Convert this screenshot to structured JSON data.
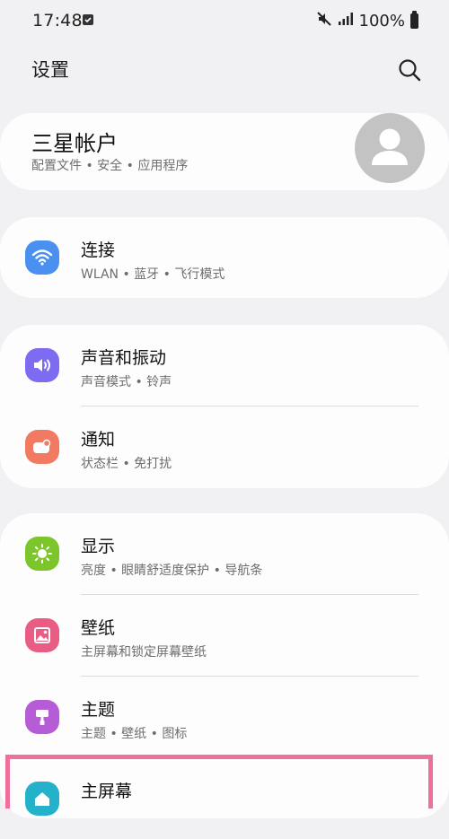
{
  "status_bar": {
    "time": "17:48",
    "battery": "100%",
    "icons": [
      "check-box-icon",
      "mute-icon",
      "signal-icon",
      "battery-icon"
    ]
  },
  "header": {
    "title": "设置",
    "search_icon": "search-icon"
  },
  "account": {
    "title": "三星帐户",
    "subtitle": "配置文件 • 安全 • 应用程序",
    "avatar_icon": "person-icon"
  },
  "groups": [
    {
      "items": [
        {
          "title": "连接",
          "subtitle": "WLAN • 蓝牙 • 飞行模式",
          "icon": "wifi-icon",
          "color": "#4a90f0"
        }
      ]
    },
    {
      "items": [
        {
          "title": "声音和振动",
          "subtitle": "声音模式 • 铃声",
          "icon": "volume-icon",
          "color": "#7d6cf1"
        },
        {
          "title": "通知",
          "subtitle": "状态栏 • 免打扰",
          "icon": "notification-icon",
          "color": "#f27a63"
        }
      ]
    },
    {
      "items": [
        {
          "title": "显示",
          "subtitle": "亮度 • 眼睛舒适度保护 • 导航条",
          "icon": "brightness-icon",
          "color": "#7cc62b"
        },
        {
          "title": "壁纸",
          "subtitle": "主屏幕和锁定屏幕壁纸",
          "icon": "wallpaper-icon",
          "color": "#e95d85"
        },
        {
          "title": "主题",
          "subtitle": "主题 • 壁纸 • 图标",
          "icon": "theme-icon",
          "color": "#b65cd6"
        },
        {
          "title": "主屏幕",
          "subtitle": "",
          "icon": "home-screen-icon",
          "color": "#23b2c9"
        }
      ]
    }
  ]
}
